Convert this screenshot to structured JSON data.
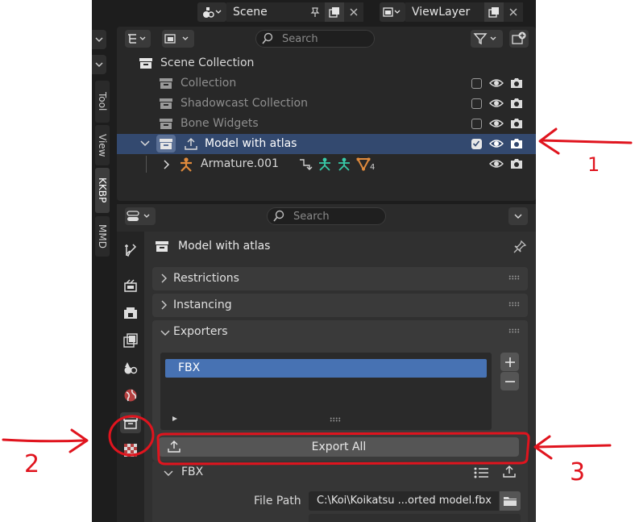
{
  "header": {
    "scene_label": "Scene",
    "viewlayer_label": "ViewLayer"
  },
  "sidebar_tabs": [
    "Tool",
    "View",
    "KKBP",
    "MMD"
  ],
  "outliner": {
    "search_placeholder": "Search",
    "items": [
      {
        "label": "Scene Collection"
      },
      {
        "label": "Collection"
      },
      {
        "label": "Shadowcast Collection"
      },
      {
        "label": "Bone Widgets"
      },
      {
        "label": "Model with atlas"
      },
      {
        "label": "Armature.001",
        "badge": "4"
      }
    ]
  },
  "properties": {
    "search_placeholder": "Search",
    "title": "Model with atlas",
    "panels": {
      "restrictions": "Restrictions",
      "instancing": "Instancing",
      "exporters": "Exporters"
    },
    "exporter_list": [
      "FBX"
    ],
    "export_all_label": "Export All",
    "fbx_subpanel": "FBX",
    "file_path_label": "File Path",
    "file_path_value": "C:\\Koi\\Koikatsu ...orted model.fbx"
  },
  "annotations": {
    "labels": [
      "1",
      "2",
      "3"
    ],
    "ink_color": "#e0141e"
  },
  "colors": {
    "selection": "#33496f",
    "list_highlight": "#4772b3",
    "armature": "#e08a3c",
    "bone": "#38c9a8"
  }
}
